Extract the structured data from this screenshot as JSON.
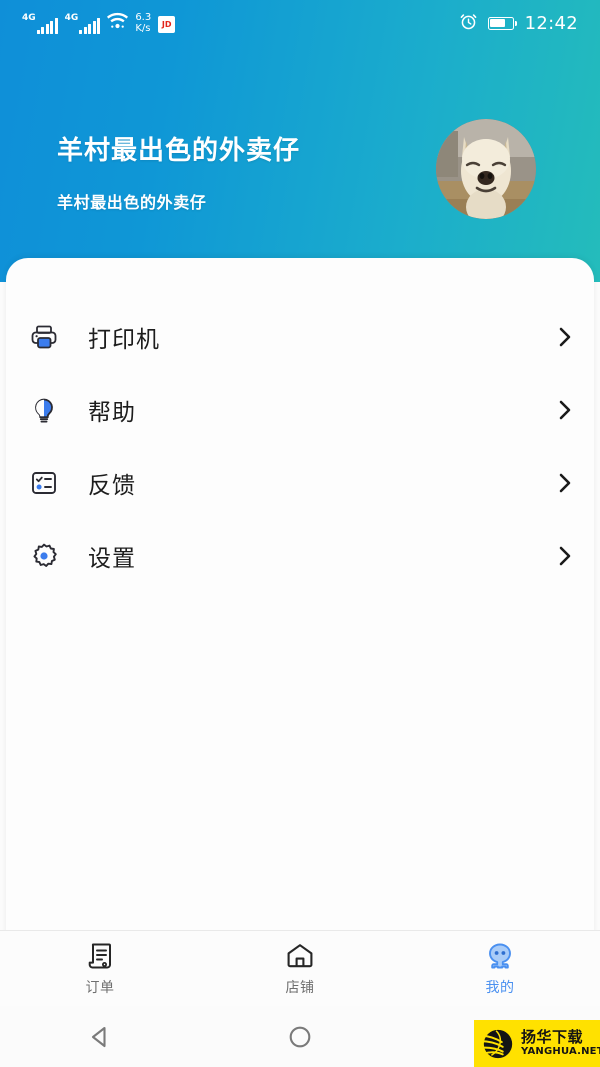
{
  "status_bar": {
    "network_1": "4G",
    "network_2": "4G",
    "speed_value": "6.3",
    "speed_unit": "K/s",
    "app_badge": "JD",
    "time": "12:42",
    "icons": [
      "signal-icon",
      "signal-icon",
      "wifi-icon",
      "alarm-icon",
      "battery-icon"
    ]
  },
  "header": {
    "title": "羊村最出色的外卖仔",
    "subtitle": "羊村最出色的外卖仔",
    "avatar_alt": "alpaca-avatar",
    "gradient_start": "#0f8fd8",
    "gradient_end": "#24bcbb"
  },
  "menu": {
    "items": [
      {
        "label": "打印机",
        "icon": "printer-icon"
      },
      {
        "label": "帮助",
        "icon": "lightbulb-icon"
      },
      {
        "label": "反馈",
        "icon": "feedback-form-icon"
      },
      {
        "label": "设置",
        "icon": "gear-icon"
      }
    ]
  },
  "tabbar": {
    "active_color": "#4a90f0",
    "tabs": [
      {
        "label": "订单",
        "icon": "receipt-icon",
        "active": false
      },
      {
        "label": "店铺",
        "icon": "store-icon",
        "active": false
      },
      {
        "label": "我的",
        "icon": "profile-robot-icon",
        "active": true
      }
    ]
  },
  "android_nav": {
    "back": "back-triangle-icon",
    "home": "home-circle-icon",
    "recents": "recents-square-icon"
  },
  "watermark": {
    "cn": "扬华下载",
    "en": "YANGHUA.NET",
    "bg": "#ffe100"
  }
}
